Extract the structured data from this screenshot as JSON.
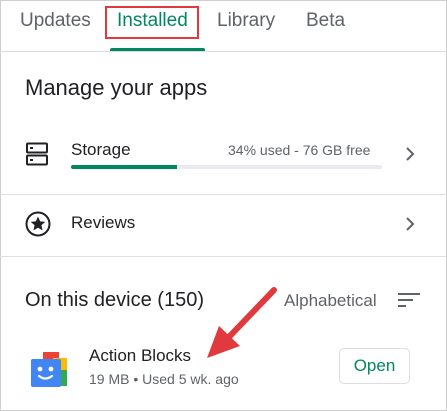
{
  "tabs": [
    {
      "label": "Updates"
    },
    {
      "label": "Installed",
      "selected": true
    },
    {
      "label": "Library"
    },
    {
      "label": "Beta"
    }
  ],
  "manage": {
    "title": "Manage your apps",
    "storage": {
      "label": "Storage",
      "info": "34% used - 76 GB free",
      "used_fraction": 0.34
    },
    "reviews": {
      "label": "Reviews"
    }
  },
  "device": {
    "title": "On this device (150)",
    "sort_label": "Alphabetical"
  },
  "apps": [
    {
      "name": "Action Blocks",
      "meta": "19 MB • Used 5 wk. ago",
      "button": "Open"
    }
  ],
  "colors": {
    "accent": "#01875f",
    "highlight": "#e0393e",
    "text": "#202124",
    "secondary": "#5f6368"
  },
  "icons": [
    "storage-icon",
    "star-circle-icon",
    "chevron-right-icon",
    "sort-icon",
    "action-blocks-app-icon"
  ]
}
